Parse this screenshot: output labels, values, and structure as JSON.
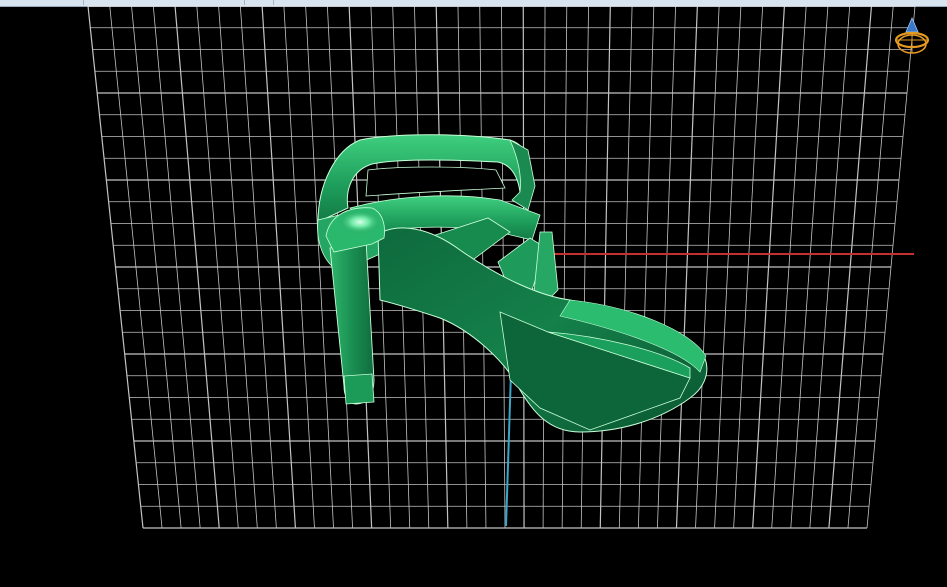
{
  "viewport": {
    "background_color": "#000000",
    "grid_color": "#e6e6e6",
    "x_axis_color": "#c23030",
    "y_axis_color": "#3aa6c8"
  },
  "model": {
    "body_color": "#1e9a5a",
    "highlight_color": "#4be08f",
    "shadow_color": "#0b5a32",
    "wire_color": "#c8ffd8"
  },
  "gizmo": {
    "name": "navigation-gizmo-icon",
    "ring_color": "#e59a22",
    "cone_color": "#3a78c8"
  }
}
